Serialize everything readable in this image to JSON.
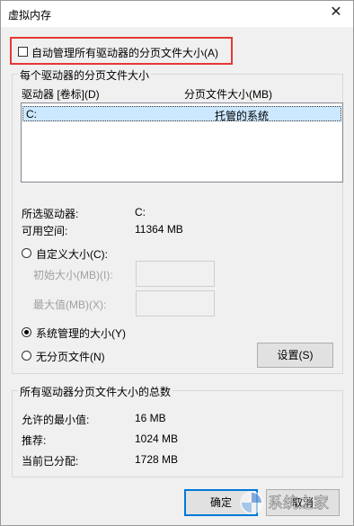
{
  "window": {
    "title": "虚拟内存",
    "close_glyph": "✕"
  },
  "auto_manage": {
    "label": "自动管理所有驱动器的分页文件大小(A)",
    "checked": false
  },
  "drives_group": {
    "title": "每个驱动器的分页文件大小",
    "col_drive": "驱动器 [卷标](D)",
    "col_size": "分页文件大小(MB)",
    "rows": [
      {
        "drive": "C:",
        "size": "托管的系统"
      }
    ],
    "selected_drive_label": "所选驱动器:",
    "selected_drive_value": "C:",
    "free_space_label": "可用空间:",
    "free_space_value": "11364 MB",
    "custom_size": "自定义大小(C):",
    "initial_size": "初始大小(MB)(I):",
    "max_size": "最大值(MB)(X):",
    "system_managed": "系统管理的大小(Y)",
    "no_paging": "无分页文件(N)",
    "set_button": "设置(S)",
    "selected_option": "system_managed"
  },
  "totals_group": {
    "title": "所有驱动器分页文件大小的总数",
    "min_label": "允许的最小值:",
    "min_value": "16 MB",
    "recommended_label": "推荐:",
    "recommended_value": "1024 MB",
    "allocated_label": "当前已分配:",
    "allocated_value": "1728 MB"
  },
  "buttons": {
    "ok": "确定",
    "cancel": "取消"
  },
  "watermark": "系统之家",
  "colors": {
    "highlight_border": "#e53935",
    "selection": "#cce8ff",
    "accent": "#0078d7"
  }
}
